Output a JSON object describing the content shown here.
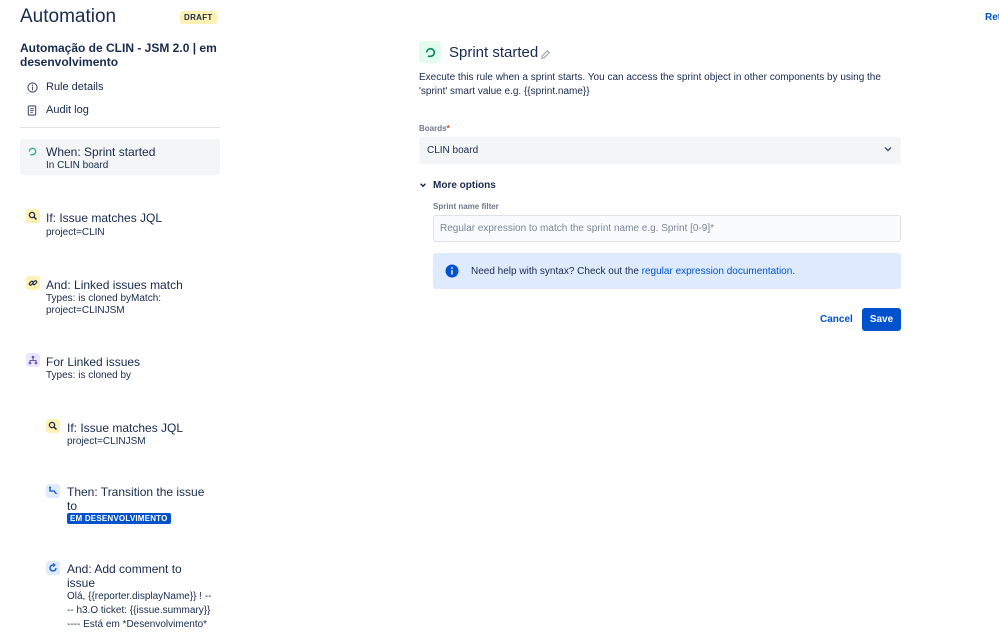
{
  "header": {
    "title": "Automation",
    "status_badge": "DRAFT",
    "top_right_link": "Ret"
  },
  "sidebar": {
    "rule_name": "Automação de CLIN - JSM 2.0 | em desenvolvimento",
    "nav": [
      {
        "label": "Rule details",
        "icon": "info-icon"
      },
      {
        "label": "Audit log",
        "icon": "document-icon"
      }
    ],
    "steps": [
      {
        "title": "When: Sprint started",
        "detail_prefix": "In",
        "detail": "CLIN board",
        "icon": "sprint-trigger-icon",
        "color": "#36b37e",
        "active": true
      },
      {
        "title": "If: Issue matches JQL",
        "detail": "project=CLIN",
        "icon": "search-icon",
        "color": "#ff991f"
      },
      {
        "title": "And: Linked issues match",
        "detail_line1": "Types: is cloned byMatch:",
        "detail_line2": "project=CLINJSM",
        "icon": "link-icon",
        "color": "#ff991f"
      },
      {
        "title": "For Linked issues",
        "detail": "Types: is cloned by",
        "icon": "branch-icon",
        "color": "#6554c0"
      },
      {
        "title": "If: Issue matches JQL",
        "detail": "project=CLINJSM",
        "icon": "search-icon",
        "color": "#ff991f"
      },
      {
        "title_line1": "Then: Transition the issue",
        "title_line2": "to",
        "status": "EM DESENVOLVIMENTO",
        "icon": "transition-icon",
        "color": "#0065ff"
      },
      {
        "title_line1": "And: Add comment to",
        "title_line2": "issue",
        "detail_line1": "Olá, {{reporter.displayName}} ! --",
        "detail_line2": "-- h3.O ticket: {{issue.summary}}",
        "detail_line3": "---- Está em *Desenvolvimento*",
        "icon": "comment-action-icon",
        "color": "#0065ff"
      }
    ]
  },
  "panel": {
    "title": "Sprint started",
    "description": "Execute this rule when a sprint starts. You can access the sprint object in other components by using the 'sprint' smart value e.g. {{sprint.name}}",
    "boards_label": "Boards",
    "required_mark": "*",
    "boards_value": "CLIN board",
    "more_options_label": "More options",
    "sprint_filter_label": "Sprint name filter",
    "sprint_filter_value": "",
    "sprint_filter_placeholder": "Regular expression to match the sprint name e.g. Sprint [0-9]*",
    "info_text": "Need help with syntax? Check out the ",
    "info_link": "regular expression documentation",
    "info_suffix": ".",
    "cancel_label": "Cancel",
    "save_label": "Save"
  },
  "colors": {
    "brand_blue": "#0052cc",
    "draft_badge_bg": "#fff0b3",
    "info_bg": "#deebff"
  }
}
